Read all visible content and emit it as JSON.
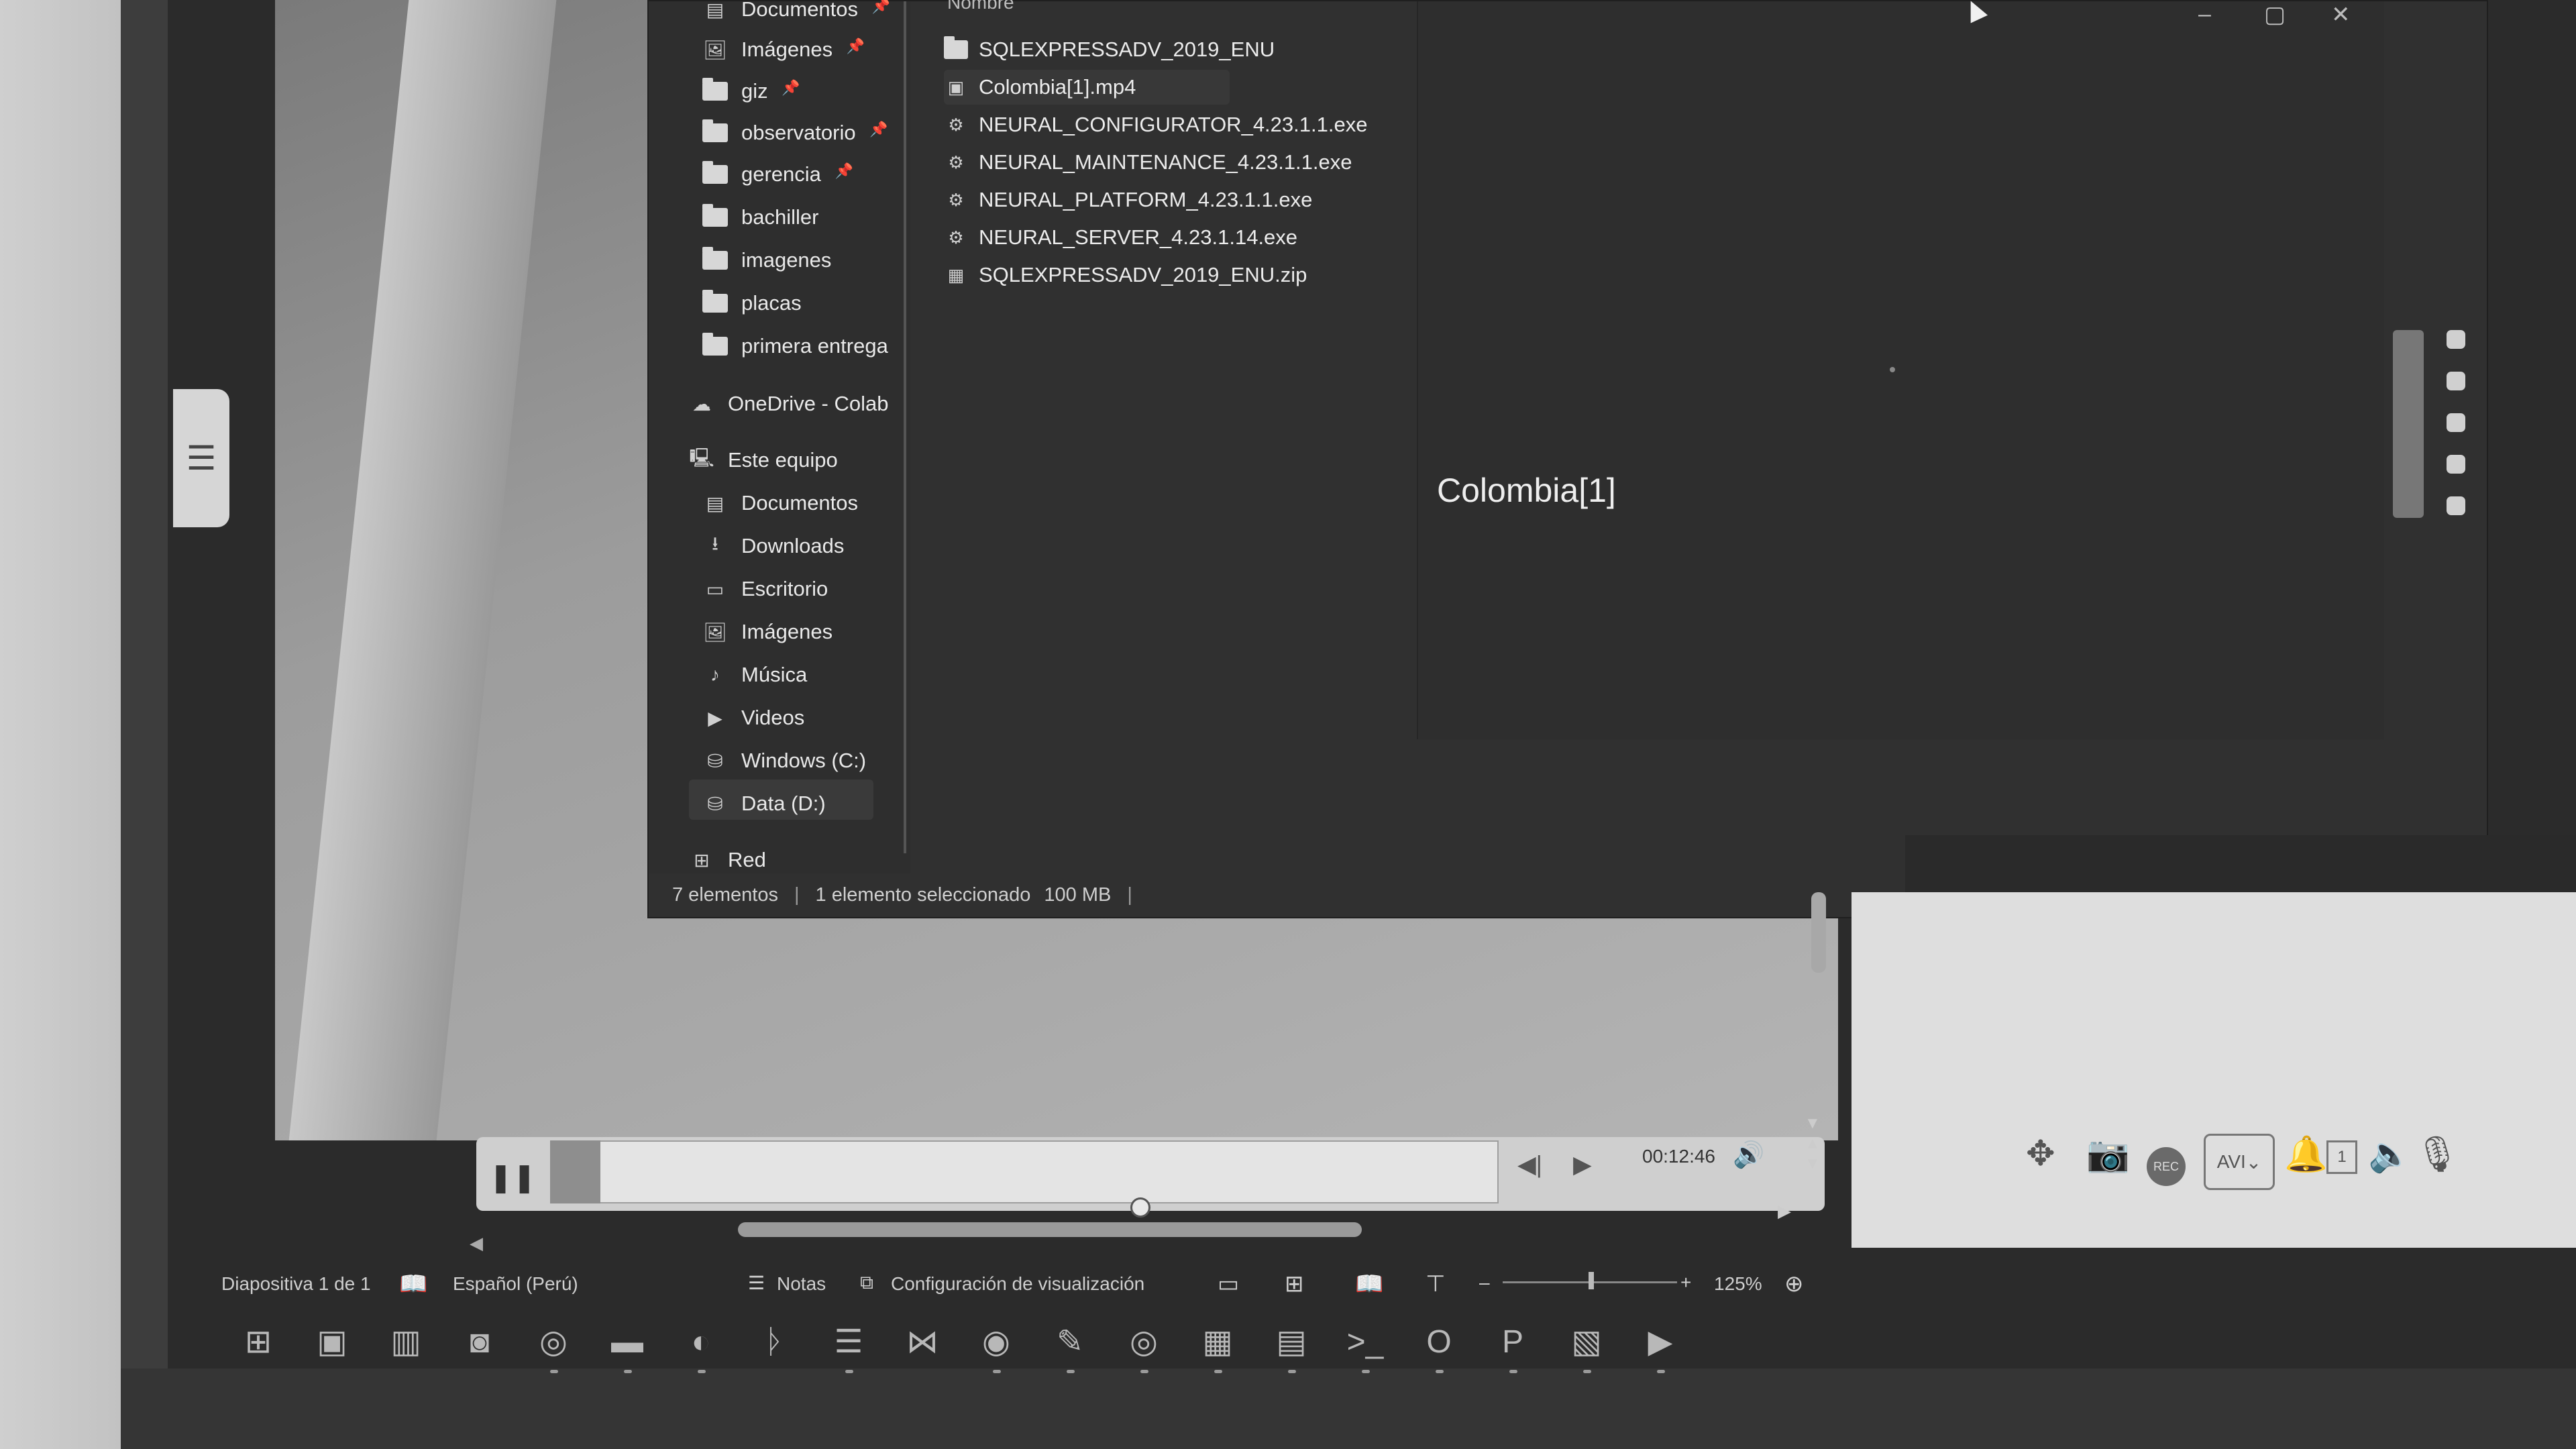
{
  "explorer": {
    "column_header": "Nombre",
    "nav_items": [
      {
        "label": "Documentos",
        "type": "docs",
        "pinned": true
      },
      {
        "label": "Imágenes",
        "type": "pics",
        "pinned": true
      },
      {
        "label": "giz",
        "type": "folder",
        "pinned": true
      },
      {
        "label": "observatorio",
        "type": "folder",
        "pinned": true
      },
      {
        "label": "gerencia",
        "type": "folder",
        "pinned": true
      },
      {
        "label": "bachiller",
        "type": "folder",
        "pinned": false
      },
      {
        "label": "imagenes",
        "type": "folder",
        "pinned": false
      },
      {
        "label": "placas",
        "type": "folder",
        "pinned": false
      },
      {
        "label": "primera entrega",
        "type": "folder",
        "pinned": false
      },
      {
        "label": "OneDrive - Colab",
        "type": "cloud",
        "pinned": false
      },
      {
        "label": "Este equipo",
        "type": "pc",
        "pinned": false
      },
      {
        "label": "Documentos",
        "type": "docs",
        "pinned": false
      },
      {
        "label": "Downloads",
        "type": "download",
        "pinned": false
      },
      {
        "label": "Escritorio",
        "type": "desktop",
        "pinned": false
      },
      {
        "label": "Imágenes",
        "type": "pics",
        "pinned": false
      },
      {
        "label": "Música",
        "type": "music",
        "pinned": false
      },
      {
        "label": "Videos",
        "type": "video",
        "pinned": false
      },
      {
        "label": "Windows (C:)",
        "type": "drive",
        "pinned": false
      },
      {
        "label": "Data (D:)",
        "type": "drive",
        "pinned": false
      },
      {
        "label": "Red",
        "type": "network",
        "pinned": false
      }
    ],
    "files": [
      {
        "name": "SQLEXPRESSADV_2019_ENU",
        "type": "folder"
      },
      {
        "name": "Colombia[1].mp4",
        "type": "video"
      },
      {
        "name": "NEURAL_CONFIGURATOR_4.23.1.1.exe",
        "type": "exe"
      },
      {
        "name": "NEURAL_MAINTENANCE_4.23.1.1.exe",
        "type": "exe"
      },
      {
        "name": "NEURAL_PLATFORM_4.23.1.1.exe",
        "type": "exe"
      },
      {
        "name": "NEURAL_SERVER_4.23.1.14.exe",
        "type": "exe"
      },
      {
        "name": "SQLEXPRESSADV_2019_ENU.zip",
        "type": "zip"
      }
    ],
    "selected_file": "Colombia[1].mp4",
    "preview_title": "Colombia[1]",
    "status": {
      "count": "7 elementos",
      "selection": "1 elemento seleccionado",
      "size": "100 MB"
    }
  },
  "player": {
    "time": "00:12:46",
    "progress": 0.053
  },
  "right_panel": {
    "rec_label": "REC",
    "format": "AVI",
    "notification_count": "1"
  },
  "ppt_status": {
    "slide": "Diapositiva 1 de 1",
    "language": "Español (Perú)",
    "notes": "Notas",
    "display_settings": "Configuración de visualización",
    "zoom": "125%"
  },
  "colors": {
    "explorer_bg": "#303030",
    "screen_bg": "#2b2b2b",
    "panel_light": "#dedede"
  }
}
